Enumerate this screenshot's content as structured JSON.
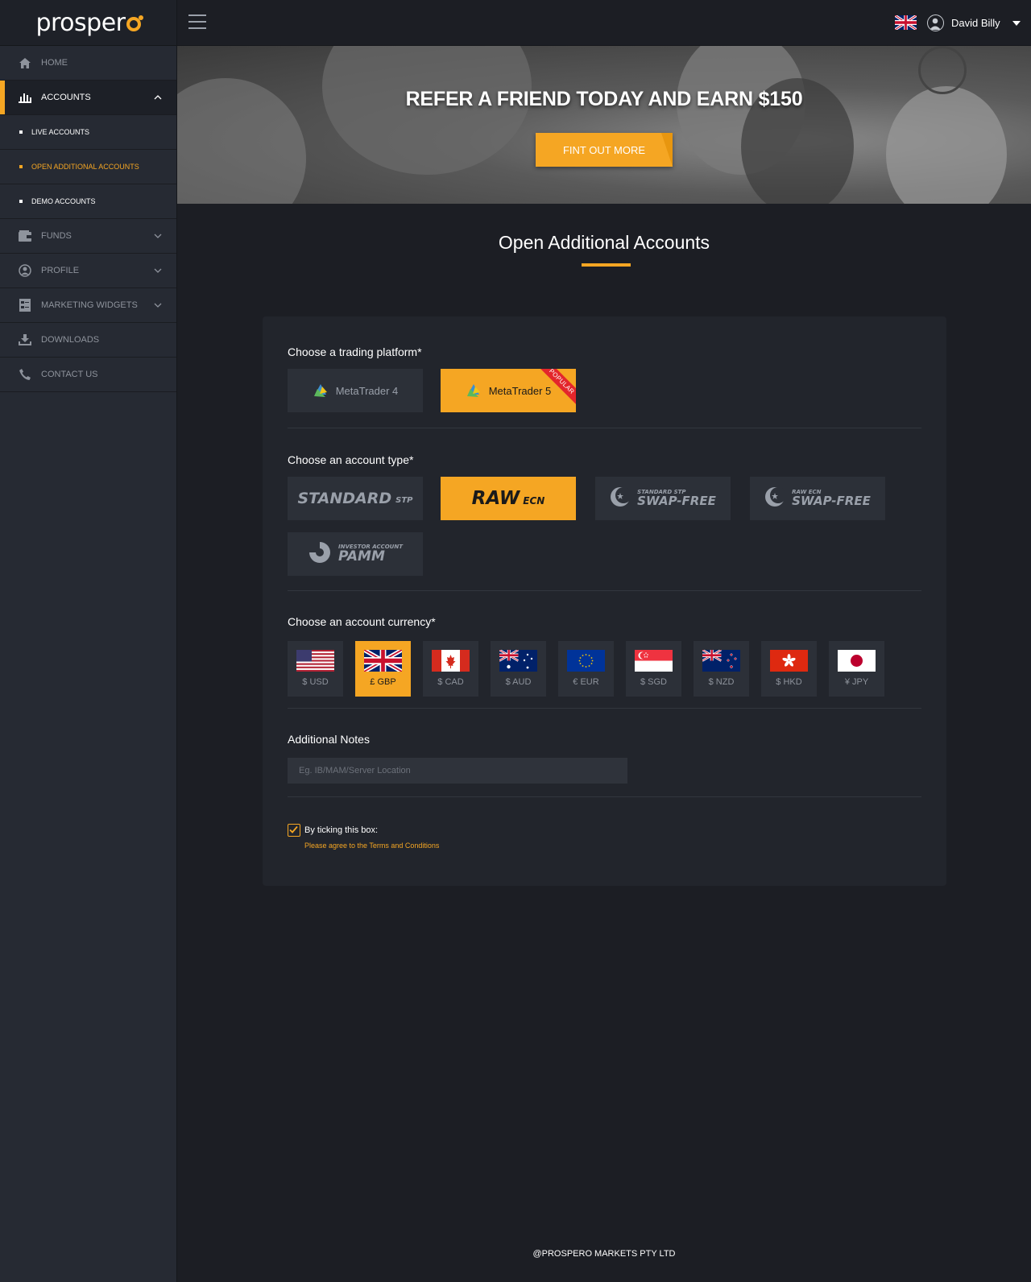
{
  "brand": {
    "name": "prosper",
    "accent": "#f5a623"
  },
  "sidebar": {
    "items": [
      {
        "label": "HOME",
        "icon": "home-icon"
      },
      {
        "label": "ACCOUNTS",
        "icon": "bar-chart-icon",
        "expanded": true
      },
      {
        "label": "LIVE ACCOUNTS"
      },
      {
        "label": "OPEN ADDITIONAL ACCOUNTS",
        "current": true
      },
      {
        "label": "DEMO ACCOUNTS"
      },
      {
        "label": "FUNDS",
        "icon": "wallet-icon"
      },
      {
        "label": "PROFILE",
        "icon": "user-circle-icon"
      },
      {
        "label": "MARKETING WIDGETS",
        "icon": "widget-icon"
      },
      {
        "label": "DOWNLOADS",
        "icon": "download-icon"
      },
      {
        "label": "CONTACT US",
        "icon": "phone-icon"
      }
    ]
  },
  "header": {
    "user_name": "David Billy",
    "language_flag": "uk-flag-icon"
  },
  "banner": {
    "title": "REFER A FRIEND TODAY AND EARN $150",
    "button": "FINT OUT MORE"
  },
  "page": {
    "title": "Open Additional Accounts"
  },
  "form": {
    "platform_label": "Choose a trading platform*",
    "platforms": [
      {
        "name": "MetaTrader 4",
        "selected": false
      },
      {
        "name": "MetaTrader 5",
        "selected": true,
        "badge": "POPULAR"
      }
    ],
    "account_type_label": "Choose an account type*",
    "account_types": [
      {
        "main": "STANDARD",
        "suffix": "STP",
        "selected": false
      },
      {
        "main": "RAW",
        "suffix": "ECN",
        "selected": true
      },
      {
        "top": "STANDARD STP",
        "main": "SWAP-FREE",
        "icon": "crescent-star-icon",
        "selected": false
      },
      {
        "top": "RAW ECN",
        "main": "SWAP-FREE",
        "icon": "crescent-star-icon",
        "selected": false
      },
      {
        "top": "INVESTOR ACCOUNT",
        "main": "PAMM",
        "icon": "pamm-icon",
        "selected": false
      }
    ],
    "currency_label": "Choose an account currency*",
    "currencies": [
      {
        "code": "$ USD",
        "flag": "us-flag-icon",
        "selected": false
      },
      {
        "code": "£ GBP",
        "flag": "uk-flag-icon",
        "selected": true
      },
      {
        "code": "$ CAD",
        "flag": "canada-flag-icon",
        "selected": false
      },
      {
        "code": "$ AUD",
        "flag": "australia-flag-icon",
        "selected": false
      },
      {
        "code": "€ EUR",
        "flag": "eu-flag-icon",
        "selected": false
      },
      {
        "code": "$ SGD",
        "flag": "singapore-flag-icon",
        "selected": false
      },
      {
        "code": "$ NZD",
        "flag": "new-zealand-flag-icon",
        "selected": false
      },
      {
        "code": "$ HKD",
        "flag": "hong-kong-flag-icon",
        "selected": false
      },
      {
        "code": "¥ JPY",
        "flag": "japan-flag-icon",
        "selected": false
      }
    ],
    "notes_label": "Additional Notes",
    "notes_placeholder": "Eg. IB/MAM/Server Location",
    "notes_value": "",
    "agree_label": "By ticking this box:",
    "agree_checked": true,
    "terms_link": "Please agree to the Terms and Conditions"
  },
  "footer": {
    "text": "@PROSPERO MARKETS PTY LTD"
  }
}
